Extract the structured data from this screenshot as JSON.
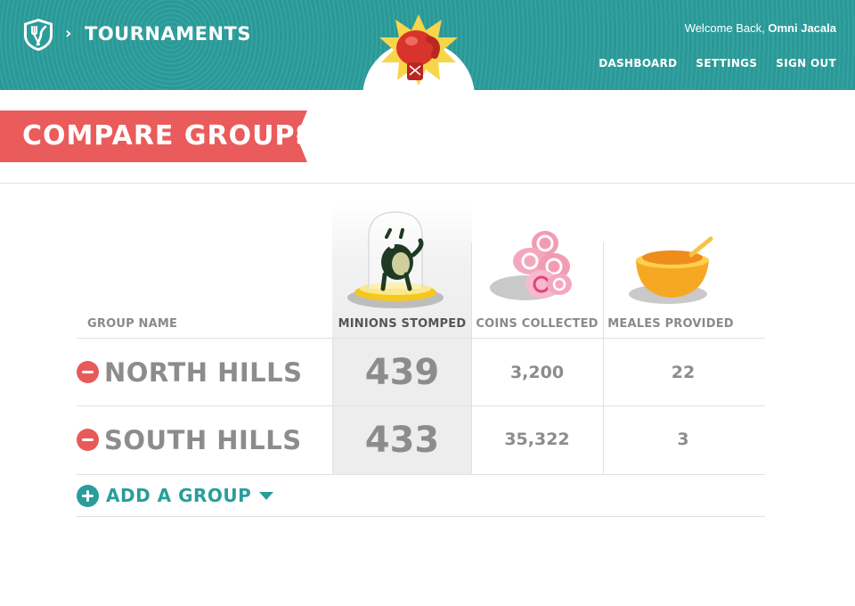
{
  "header": {
    "breadcrumb_separator": "›",
    "title": "TOURNAMENTS",
    "welcome_prefix": "Welcome Back,",
    "user_name": "Omni Jacala",
    "nav": [
      {
        "label": "DASHBOARD"
      },
      {
        "label": "SETTINGS"
      },
      {
        "label": "SIGN OUT"
      }
    ],
    "logo_icon": "shield-fork-knife-icon",
    "mascot_icon": "boxing-glove-burst-icon"
  },
  "page": {
    "title": "COMPARE GROUPS"
  },
  "table": {
    "columns": [
      {
        "label": "GROUP NAME"
      },
      {
        "label": "MINIONS STOMPED",
        "icon": "minion-trophy-icon",
        "active": true
      },
      {
        "label": "COINS COLLECTED",
        "icon": "coin-stack-icon"
      },
      {
        "label": "MEALES PROVIDED",
        "icon": "meal-bowl-icon"
      }
    ],
    "rows": [
      {
        "name": "NORTH HILLS",
        "minions": "439",
        "coins": "3,200",
        "meals": "22"
      },
      {
        "name": "SOUTH HILLS",
        "minions": "433",
        "coins": "35,322",
        "meals": "3"
      }
    ],
    "add_group_label": "ADD A GROUP"
  },
  "colors": {
    "teal": "#2a9d9b",
    "ribbon_red": "#ea5b5b",
    "text_gray": "#8c8c8c"
  }
}
